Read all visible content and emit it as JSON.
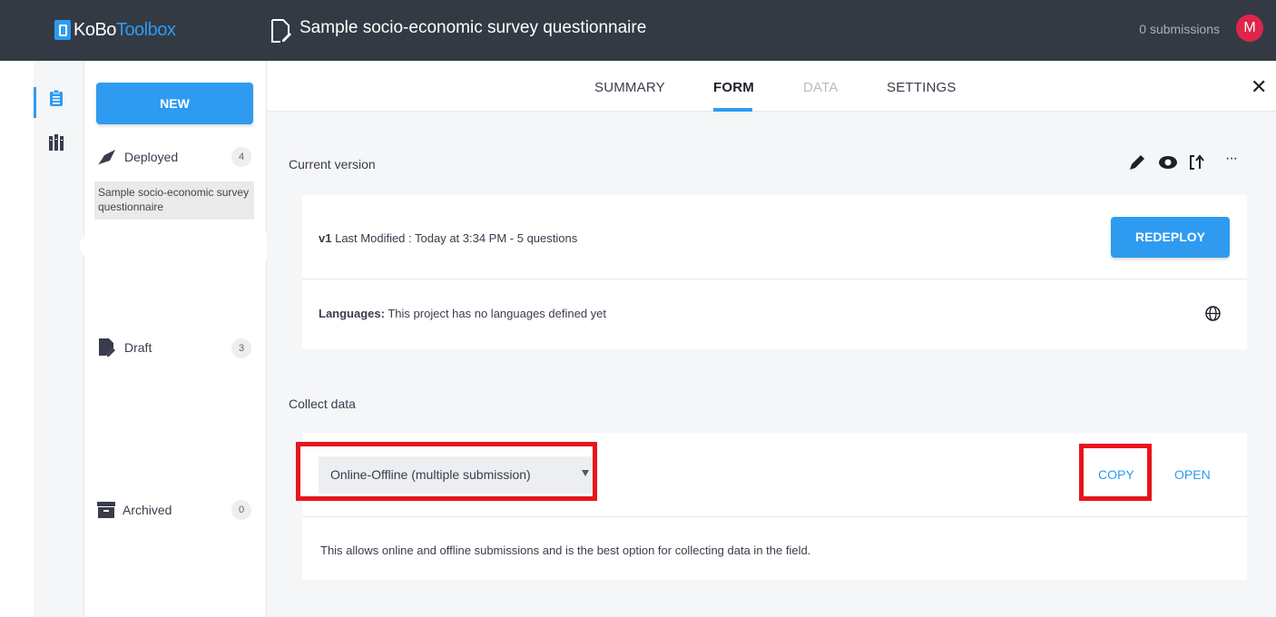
{
  "header": {
    "logo_kobo": "KoBo",
    "logo_toolbox": "Toolbox",
    "project_title": "Sample socio-economic survey questionnaire",
    "submissions": "0 submissions",
    "avatar_initial": "M"
  },
  "sidebar": {
    "new_label": "NEW",
    "deployed": {
      "label": "Deployed",
      "count": "4"
    },
    "draft": {
      "label": "Draft",
      "count": "3"
    },
    "archived": {
      "label": "Archived",
      "count": "0"
    },
    "asset_item": "Sample socio-economic survey questionnaire"
  },
  "tabs": {
    "summary": "SUMMARY",
    "form": "FORM",
    "data": "DATA",
    "settings": "SETTINGS",
    "active": "FORM"
  },
  "form": {
    "current_version_label": "Current version",
    "version_tag": "v1",
    "version_info": "Last Modified : Today at 3:34 PM - 5 questions",
    "redeploy_label": "REDEPLOY",
    "languages_label": "Languages:",
    "languages_text": "This project has no languages defined yet",
    "collect_data_label": "Collect data",
    "collect_method": "Online-Offline (multiple submission)",
    "copy_label": "COPY",
    "open_label": "OPEN",
    "collect_description": "This allows online and offline submissions and is the best option for collecting data in the field."
  },
  "colors": {
    "topbar": "#333a44",
    "accent": "#2e9bf0",
    "highlight": "#e8141d",
    "avatar": "#e0244a"
  },
  "icons": [
    "clipboard-icon",
    "library-icon",
    "rocket-icon",
    "draft-icon",
    "archive-icon",
    "pencil-icon",
    "eye-icon",
    "replace-icon",
    "more-icon",
    "globe-icon",
    "close-icon",
    "form-file-icon"
  ]
}
